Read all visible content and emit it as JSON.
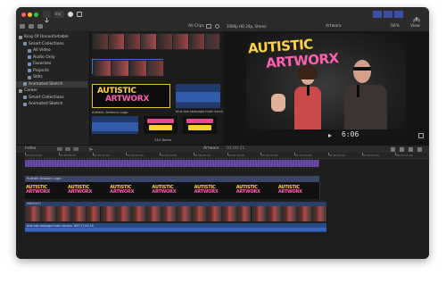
{
  "toolbar": {
    "mode_label": "Inx",
    "window_buttons_colors": [
      "#ff5f57",
      "#febc2e",
      "#28c840"
    ]
  },
  "browser": {
    "filter_label": "All Clips",
    "library_items": [
      {
        "label": "King Of Unconfortable",
        "indent": 0,
        "icon": "library-icon"
      },
      {
        "label": "Smart Collections",
        "indent": 1,
        "icon": "folder-icon"
      },
      {
        "label": "All Video",
        "indent": 2,
        "icon": "video-icon"
      },
      {
        "label": "Audio Only",
        "indent": 2,
        "icon": "audio-icon"
      },
      {
        "label": "Favorites",
        "indent": 2,
        "icon": "star-icon"
      },
      {
        "label": "Projects",
        "indent": 2,
        "icon": "film-icon"
      },
      {
        "label": "Stills",
        "indent": 2,
        "icon": "image-icon"
      },
      {
        "label": "Animated Sketch",
        "indent": 1,
        "icon": "event-icon",
        "selected": true
      },
      {
        "label": "Career",
        "indent": 0,
        "icon": "library-icon"
      },
      {
        "label": "Smart Collections",
        "indent": 1,
        "icon": "folder-icon"
      },
      {
        "label": "Animated Sketch",
        "indent": 1,
        "icon": "event-icon"
      }
    ],
    "clip1_label": "Autistic Artworx Logo",
    "clip2_label": "blue sea seascape main version 180",
    "items_count": "241 Items"
  },
  "viewer": {
    "format_label": "1080p HD 24p, Stereo",
    "project_label": "Artworx",
    "zoom_label": "66%",
    "view_label": "View",
    "timecode": "6:06",
    "overlay_line1": "AUTISTIC",
    "overlay_line2": "ARTWORX"
  },
  "timeline": {
    "index_label": "Index",
    "project_label": "Artworx",
    "duration_label": "01:00:21",
    "ruler_labels": [
      "00:00:00:00",
      "00:00:05:00",
      "00:00:10:00",
      "00:00:15:00",
      "00:00:20:00",
      "00:00:25:00",
      "00:00:30:00",
      "00:00:35:00",
      "00:00:40:00",
      "00:00:45:00",
      "00:00:50:00",
      "00:00:55:00"
    ],
    "title_clip_label": "Autistic Artworx Logo",
    "video_clip_label": "IS8A5457",
    "audio_clip_label": "blue sea seascape main version 180717-00-16",
    "logo_line1": "AUTISTIC",
    "logo_line2": "ARTWORX"
  }
}
